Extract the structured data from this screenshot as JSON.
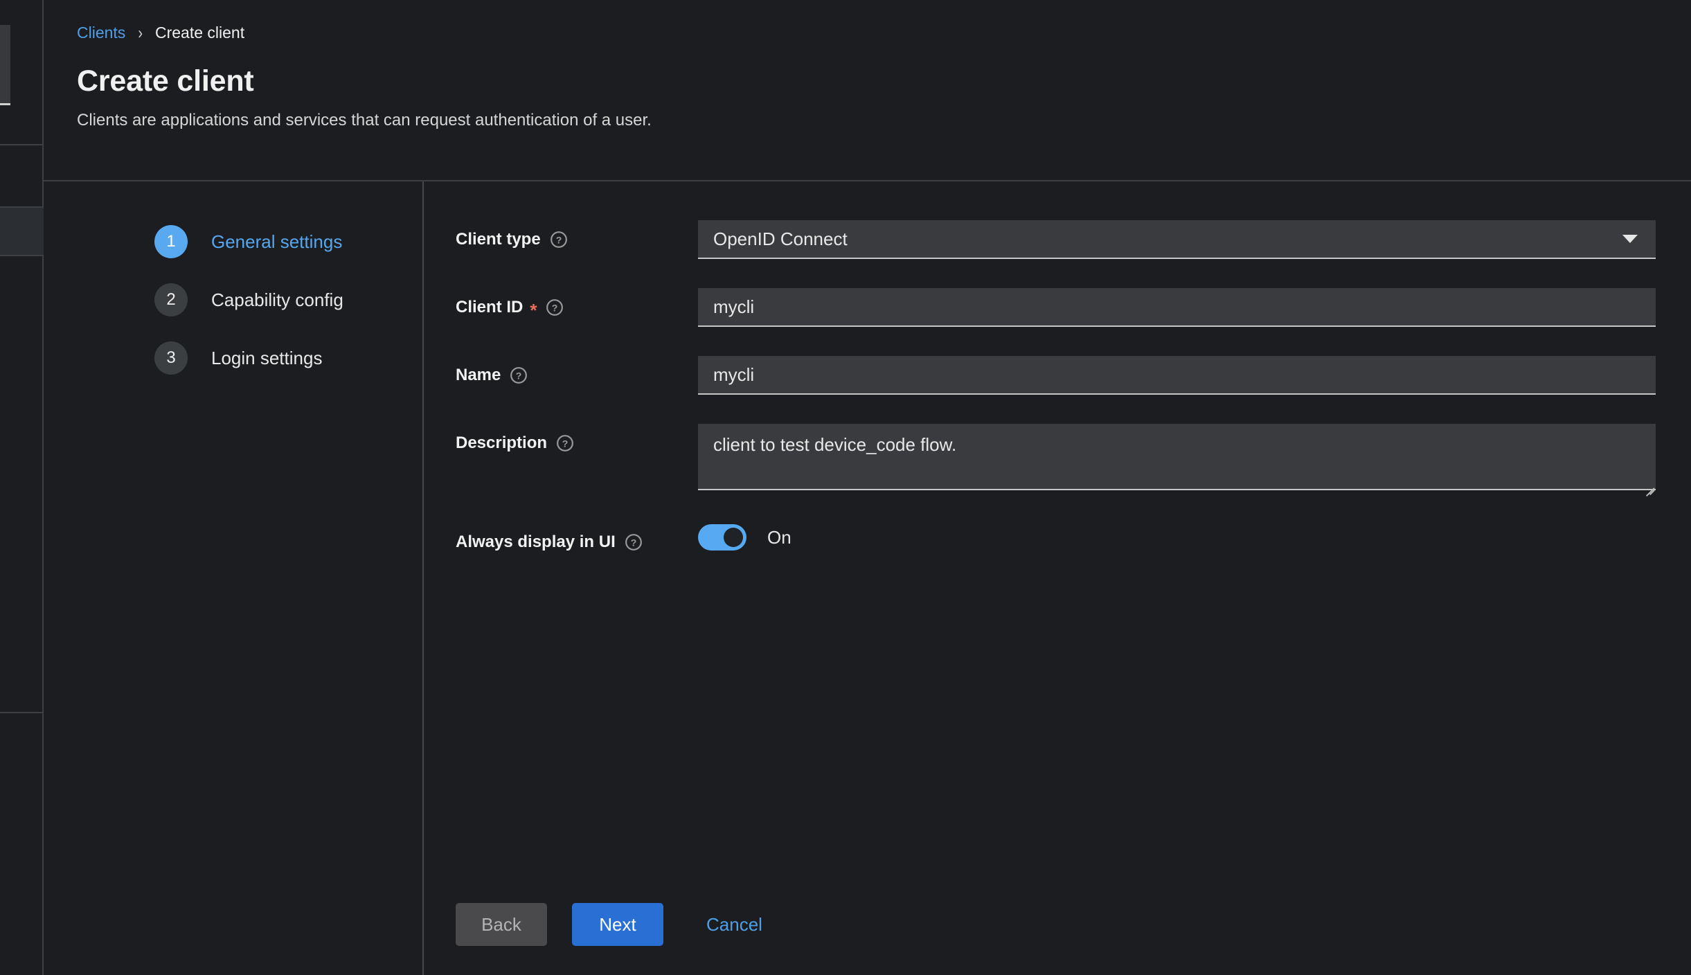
{
  "breadcrumb": {
    "parent": "Clients",
    "separator": "›",
    "current": "Create client"
  },
  "header": {
    "title": "Create client",
    "subtitle": "Clients are applications and services that can request authentication of a user."
  },
  "wizard": {
    "steps": [
      {
        "number": "1",
        "label": "General settings",
        "active": true
      },
      {
        "number": "2",
        "label": "Capability config",
        "active": false
      },
      {
        "number": "3",
        "label": "Login settings",
        "active": false
      }
    ]
  },
  "form": {
    "client_type": {
      "label": "Client type",
      "help_icon": "question-circle-icon",
      "value": "OpenID Connect",
      "caret_icon": "chevron-down-icon"
    },
    "client_id": {
      "label": "Client ID",
      "required_marker": "*",
      "help_icon": "question-circle-icon",
      "value": "mycli",
      "placeholder": ""
    },
    "name": {
      "label": "Name",
      "help_icon": "question-circle-icon",
      "value": "mycli",
      "placeholder": ""
    },
    "description": {
      "label": "Description",
      "help_icon": "question-circle-icon",
      "value": "client to test device_code flow.",
      "placeholder": ""
    },
    "always_display": {
      "label": "Always display in UI",
      "help_icon": "question-circle-icon",
      "state_label": "On",
      "checked": true
    }
  },
  "actions": {
    "back": "Back",
    "next": "Next",
    "cancel": "Cancel"
  },
  "colors": {
    "page_bg": "#1b1d21",
    "accent_blue": "#4f9fe8",
    "primary_button": "#2a6fd4",
    "toggle_on": "#57a9f2",
    "required_star": "#e8705a",
    "input_bg": "#3a3b3e",
    "input_underline": "#c7c7c7",
    "step_inactive": "#3c3f42",
    "step_active": "#58a9f0"
  }
}
